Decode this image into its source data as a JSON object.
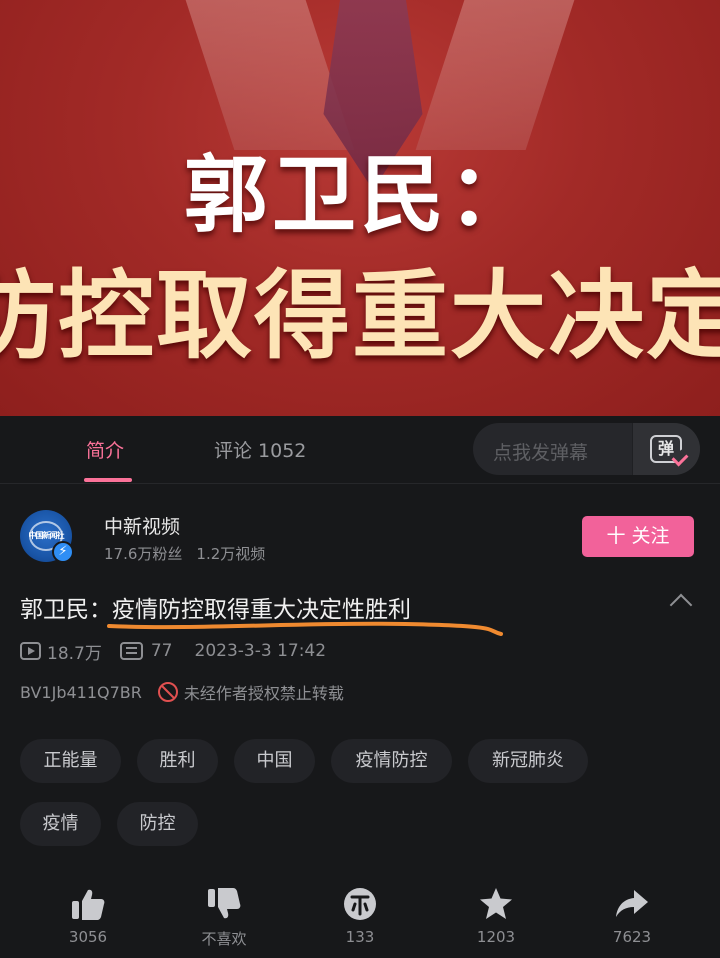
{
  "video": {
    "caption_line1": "郭卫民：",
    "caption_line2": "防控取得重大决定性"
  },
  "tabs": [
    {
      "label": "简介"
    },
    {
      "label": "评论 1052"
    }
  ],
  "danmu": {
    "placeholder": "点我发弹幕",
    "button_glyph": "弹"
  },
  "uploader": {
    "avatar_text": "中国新闻社",
    "name": "中新视频",
    "fans": "17.6万粉丝",
    "videos": "1.2万视频",
    "follow_label": "十 关注"
  },
  "video_info": {
    "title": "郭卫民：疫情防控取得重大决定性胜利",
    "views": "18.7万",
    "danmaku_count": "77",
    "date": "2023-3-3 17:42",
    "bvid": "BV1Jb411Q7BR",
    "copyright_notice": "未经作者授权禁止转载"
  },
  "tags": [
    "正能量",
    "胜利",
    "中国",
    "疫情防控",
    "新冠肺炎",
    "疫情",
    "防控"
  ],
  "actions": {
    "like": "3056",
    "dislike": "不喜欢",
    "coin": "133",
    "favorite": "1203",
    "share": "7623"
  },
  "colors": {
    "accent": "#fb7299",
    "follow_button": "#f2629a",
    "background": "#17181a",
    "underline_annotation": "#f08a30"
  }
}
